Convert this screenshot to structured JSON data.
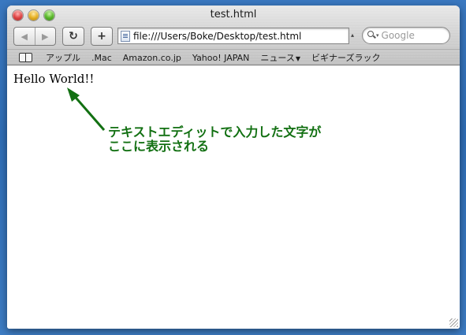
{
  "window": {
    "title": "test.html"
  },
  "toolbar": {
    "back_glyph": "◀",
    "forward_glyph": "▶",
    "reload_glyph": "↻",
    "add_glyph": "+",
    "address": "file:///Users/Boke/Desktop/test.html",
    "search_placeholder": "Google"
  },
  "bookmarks": {
    "items": [
      {
        "label": "アップル"
      },
      {
        "label": ".Mac"
      },
      {
        "label": "Amazon.co.jp"
      },
      {
        "label": "Yahoo! JAPAN"
      },
      {
        "label": "ニュース"
      },
      {
        "label": "ビギナーズラック"
      }
    ]
  },
  "page": {
    "body_text": "Hello World!!"
  },
  "annotation": {
    "line1": "テキストエディットで入力した文字が",
    "line2": "ここに表示される",
    "color": "#127012"
  }
}
